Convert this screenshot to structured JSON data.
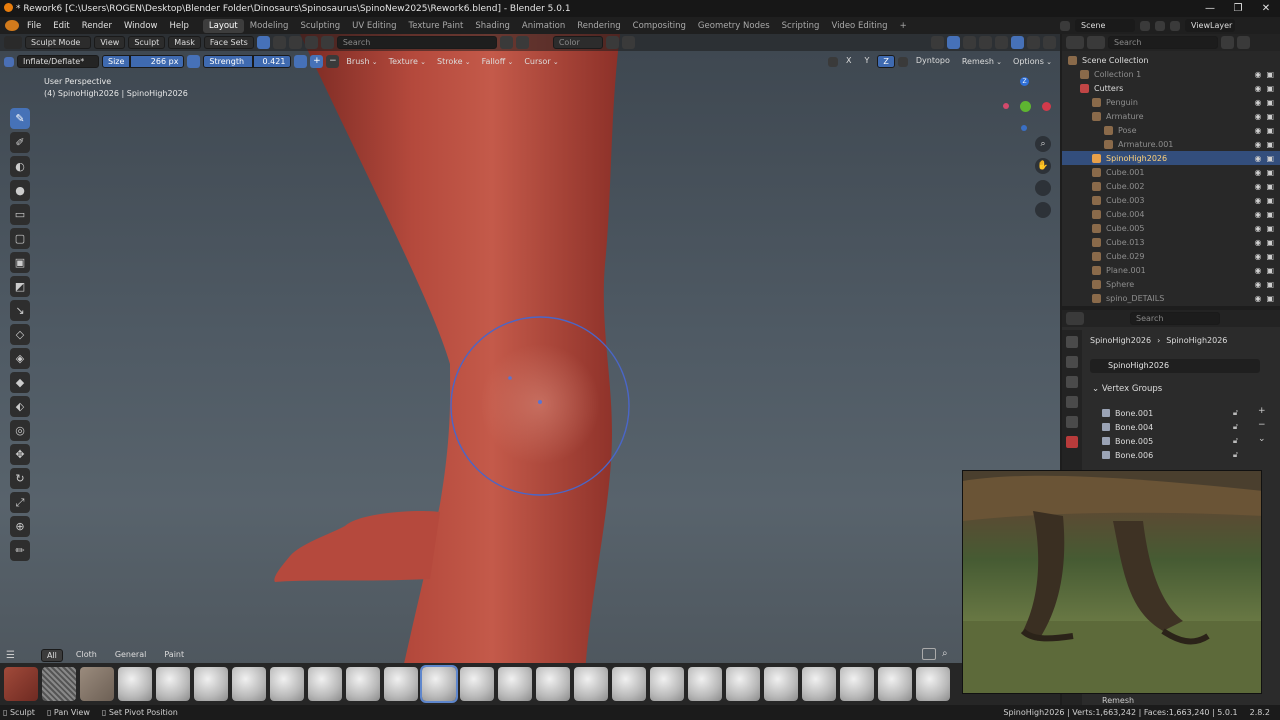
{
  "window": {
    "title": "* Rework6 [C:\\Users\\ROGEN\\Desktop\\Blender Folder\\Dinosaurs\\Spinosaurus\\SpinoNew2025\\Rework6.blend] - Blender 5.0.1",
    "controls": [
      "—",
      "❐",
      "✕"
    ]
  },
  "menu": [
    "File",
    "Edit",
    "Render",
    "Window",
    "Help"
  ],
  "workspaces": [
    "Layout",
    "Modeling",
    "Sculpting",
    "UV Editing",
    "Texture Paint",
    "Shading",
    "Animation",
    "Rendering",
    "Compositing",
    "Geometry Nodes",
    "Scripting",
    "Video Editing",
    "+"
  ],
  "active_workspace": "Layout",
  "scene": {
    "scene_label": "Scene",
    "viewlayer_label": "ViewLayer"
  },
  "viewport_header": {
    "mode": "Sculpt Mode",
    "menus": [
      "View",
      "Sculpt",
      "Mask",
      "Face Sets"
    ],
    "search_placeholder": "Search",
    "color_label": "Color"
  },
  "tool_header": {
    "brush_name": "Inflate/Deflate*",
    "size_label": "Size",
    "size_value": "266 px",
    "strength_label": "Strength",
    "strength_value": "0.421",
    "dropdowns": [
      "Brush",
      "Texture",
      "Stroke",
      "Falloff",
      "Cursor"
    ],
    "axes": [
      "X",
      "Y",
      "Z"
    ],
    "dyntopo": "Dyntopo",
    "remesh": "Remesh",
    "options": "Options"
  },
  "viewport_info": {
    "perspective": "User Perspective",
    "object": "(4) SpinoHigh2026 | SpinoHigh2026"
  },
  "gizmo_labels": [
    "Z"
  ],
  "outliner": {
    "search_placeholder": "Search",
    "rows": [
      {
        "label": "Scene Collection",
        "indent": 0,
        "dim": false,
        "selected": false
      },
      {
        "label": "Collection 1",
        "indent": 1,
        "dim": true,
        "selected": false
      },
      {
        "label": "Cutters",
        "indent": 1,
        "dim": false,
        "selected": false
      },
      {
        "label": "Penguin",
        "indent": 2,
        "dim": true,
        "selected": false
      },
      {
        "label": "Armature",
        "indent": 2,
        "dim": true,
        "selected": false
      },
      {
        "label": "Pose",
        "indent": 3,
        "dim": true,
        "selected": false
      },
      {
        "label": "Armature.001",
        "indent": 3,
        "dim": true,
        "selected": false
      },
      {
        "label": "SpinoHigh2026",
        "indent": 2,
        "dim": false,
        "selected": true
      },
      {
        "label": "Cube.001",
        "indent": 2,
        "dim": true,
        "selected": false
      },
      {
        "label": "Cube.002",
        "indent": 2,
        "dim": true,
        "selected": false
      },
      {
        "label": "Cube.003",
        "indent": 2,
        "dim": true,
        "selected": false
      },
      {
        "label": "Cube.004",
        "indent": 2,
        "dim": true,
        "selected": false
      },
      {
        "label": "Cube.005",
        "indent": 2,
        "dim": true,
        "selected": false
      },
      {
        "label": "Cube.013",
        "indent": 2,
        "dim": true,
        "selected": false
      },
      {
        "label": "Cube.029",
        "indent": 2,
        "dim": true,
        "selected": false
      },
      {
        "label": "Plane.001",
        "indent": 2,
        "dim": true,
        "selected": false
      },
      {
        "label": "Sphere",
        "indent": 2,
        "dim": true,
        "selected": false
      },
      {
        "label": "spino_DETAILS",
        "indent": 2,
        "dim": true,
        "selected": false
      }
    ]
  },
  "properties": {
    "search_placeholder": "Search",
    "breadcrumb": [
      "SpinoHigh2026",
      "SpinoHigh2026"
    ],
    "data_name": "SpinoHigh2026",
    "panel_title": "Vertex Groups",
    "vertex_groups": [
      "Bone.001",
      "Bone.004",
      "Bone.005",
      "Bone.006"
    ],
    "bottom_panel": "Remesh"
  },
  "asset_shelf": {
    "tabs": [
      "All",
      "Cloth",
      "General",
      "Paint"
    ],
    "active_tab": "All"
  },
  "statusbar": {
    "left": [
      "Sculpt",
      "Pan View",
      "Set Pivot Position"
    ],
    "right": "SpinoHigh2026 | Verts:1,663,242 | Faces:1,663,240 | 5.0.1",
    "version": "2.8.2"
  },
  "colors": {
    "accent": "#4772b3",
    "skin": "#b2463a",
    "brush_circle": "#4a66c8"
  }
}
